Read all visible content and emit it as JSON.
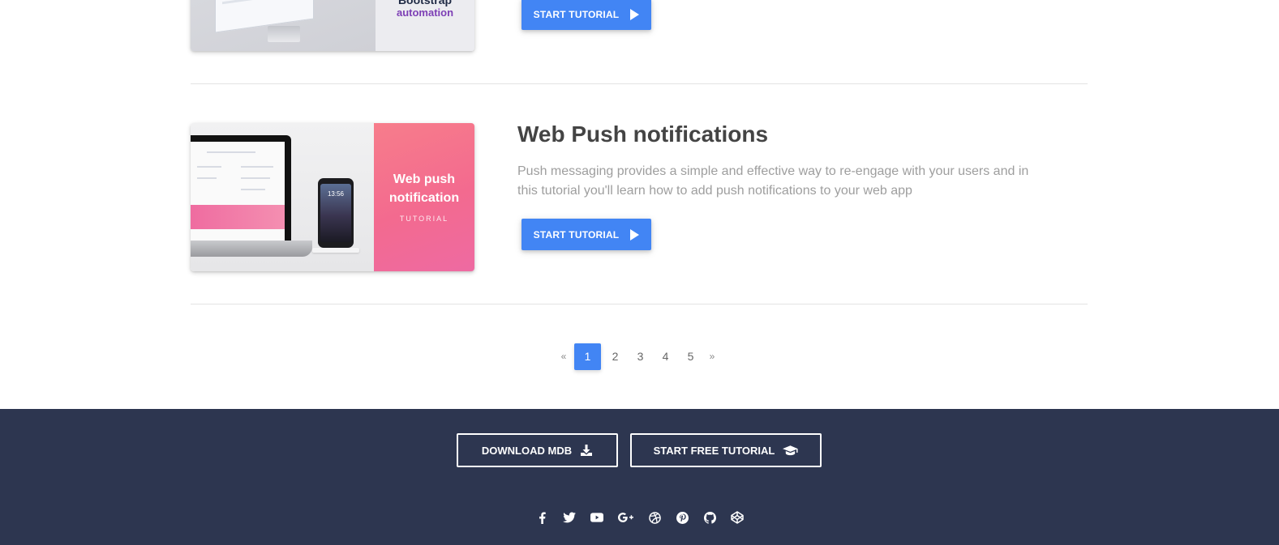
{
  "tutorials": [
    {
      "thumb_lines": [
        "Bootstrap",
        "automation"
      ],
      "button_label": "START TUTORIAL"
    },
    {
      "title": "Web Push notifications",
      "description": "Push messaging provides a simple and effective way to re-engage with your users and in this tutorial you'll learn how to add push notifications to your web app",
      "thumb_title_1": "Web push",
      "thumb_title_2": "notification",
      "thumb_subtitle": "TUTORIAL",
      "phone_time": "13:56",
      "button_label": "START TUTORIAL"
    }
  ],
  "pagination": {
    "prev": "«",
    "pages": [
      "1",
      "2",
      "3",
      "4",
      "5"
    ],
    "active_page": "1",
    "next": "»"
  },
  "footer": {
    "download_label": "DOWNLOAD MDB",
    "free_tutorial_label": "START FREE TUTORIAL",
    "socials": [
      "facebook-icon",
      "twitter-icon",
      "youtube-icon",
      "google-plus-icon",
      "dribbble-icon",
      "pinterest-icon",
      "github-icon",
      "codepen-icon"
    ]
  },
  "colors": {
    "primary": "#4285f4",
    "footer_bg": "#2d3650",
    "title_text": "#444444",
    "desc_text": "#9e9e9e"
  }
}
